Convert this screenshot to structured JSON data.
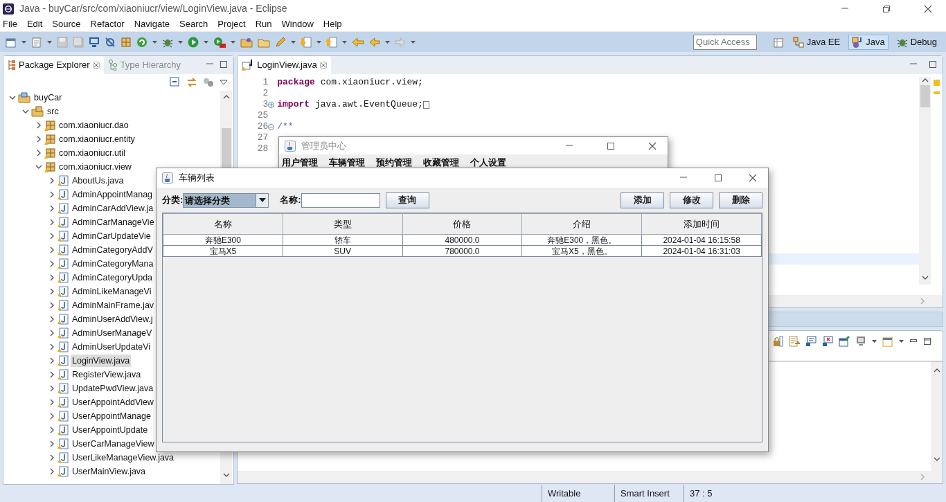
{
  "window": {
    "title": "Java - buyCar/src/com/xiaoniucr/view/LoginView.java - Eclipse"
  },
  "menu": [
    "File",
    "Edit",
    "Source",
    "Refactor",
    "Navigate",
    "Search",
    "Project",
    "Run",
    "Window",
    "Help"
  ],
  "quick_access": {
    "placeholder": "Quick Access"
  },
  "perspectives": [
    {
      "label": "Java EE",
      "selected": false
    },
    {
      "label": "Java",
      "selected": true
    },
    {
      "label": "Debug",
      "selected": false
    }
  ],
  "explorer": {
    "tabs": [
      {
        "label": "Package Explorer",
        "selected": true
      },
      {
        "label": "Type Hierarchy",
        "selected": false
      }
    ],
    "tree": [
      {
        "label": "buyCar",
        "kind": "project",
        "expanded": true,
        "selected": false,
        "children": [
          {
            "label": "src",
            "kind": "source",
            "expanded": true,
            "selected": false,
            "children": [
              {
                "label": "com.xiaoniucr.dao",
                "kind": "package",
                "expanded": false,
                "selected": false
              },
              {
                "label": "com.xiaoniucr.entity",
                "kind": "package",
                "expanded": false,
                "selected": false
              },
              {
                "label": "com.xiaoniucr.util",
                "kind": "package",
                "expanded": false,
                "selected": false
              },
              {
                "label": "com.xiaoniucr.view",
                "kind": "package",
                "expanded": true,
                "selected": false,
                "children": [
                  {
                    "label": "AboutUs.java",
                    "kind": "file",
                    "expanded": false,
                    "selected": false
                  },
                  {
                    "label": "AdminAppointManag",
                    "kind": "file",
                    "expanded": false,
                    "selected": false
                  },
                  {
                    "label": "AdminCarAddView.ja",
                    "kind": "file",
                    "expanded": false,
                    "selected": false
                  },
                  {
                    "label": "AdminCarManageVie",
                    "kind": "file",
                    "expanded": false,
                    "selected": false
                  },
                  {
                    "label": "AdminCarUpdateVie",
                    "kind": "file",
                    "expanded": false,
                    "selected": false
                  },
                  {
                    "label": "AdminCategoryAddV",
                    "kind": "file",
                    "expanded": false,
                    "selected": false
                  },
                  {
                    "label": "AdminCategoryMana",
                    "kind": "file",
                    "expanded": false,
                    "selected": false
                  },
                  {
                    "label": "AdminCategoryUpda",
                    "kind": "file",
                    "expanded": false,
                    "selected": false
                  },
                  {
                    "label": "AdminLikeManageVi",
                    "kind": "file",
                    "expanded": false,
                    "selected": false
                  },
                  {
                    "label": "AdminMainFrame.jav",
                    "kind": "file",
                    "expanded": false,
                    "selected": false
                  },
                  {
                    "label": "AdminUserAddView.j",
                    "kind": "file",
                    "expanded": false,
                    "selected": false
                  },
                  {
                    "label": "AdminUserManageV",
                    "kind": "file",
                    "expanded": false,
                    "selected": false
                  },
                  {
                    "label": "AdminUserUpdateVi",
                    "kind": "file",
                    "expanded": false,
                    "selected": false
                  },
                  {
                    "label": "LoginView.java",
                    "kind": "file",
                    "expanded": false,
                    "selected": true
                  },
                  {
                    "label": "RegisterView.java",
                    "kind": "file",
                    "expanded": false,
                    "selected": false
                  },
                  {
                    "label": "UpdatePwdView.java",
                    "kind": "file",
                    "expanded": false,
                    "selected": false
                  },
                  {
                    "label": "UserAppointAddView",
                    "kind": "file",
                    "expanded": false,
                    "selected": false
                  },
                  {
                    "label": "UserAppointManage",
                    "kind": "file",
                    "expanded": false,
                    "selected": false
                  },
                  {
                    "label": "UserAppointUpdate",
                    "kind": "file",
                    "expanded": false,
                    "selected": false
                  },
                  {
                    "label": "UserCarManageView",
                    "kind": "file",
                    "expanded": false,
                    "selected": false
                  },
                  {
                    "label": "UserLikeManageView.java",
                    "kind": "file",
                    "expanded": false,
                    "selected": false
                  },
                  {
                    "label": "UserMainView.java",
                    "kind": "file",
                    "expanded": false,
                    "selected": false
                  }
                ]
              }
            ]
          }
        ]
      }
    ]
  },
  "editor": {
    "tabs": [
      {
        "label": "LoginView.java",
        "selected": true
      }
    ],
    "lines": [
      {
        "number": "1",
        "kind": "code",
        "keyword": "package",
        "text": " com.xiaoniucr.view;"
      },
      {
        "number": "2",
        "kind": "blank"
      },
      {
        "number": "3",
        "kind": "code",
        "folded": true,
        "keyword": "import",
        "text": " java.awt.EventQueue;"
      },
      {
        "number": "25",
        "kind": "blank"
      },
      {
        "number": "26",
        "kind": "comment",
        "folded": false,
        "text": "/**"
      },
      {
        "number": "27",
        "kind": "blank"
      },
      {
        "number": "28",
        "kind": "blank"
      }
    ]
  },
  "admin_window": {
    "title": "管理员中心",
    "menu": [
      "用户管理",
      "车辆管理",
      "预约管理",
      "收藏管理",
      "个人设置"
    ]
  },
  "car_window": {
    "title": "车辆列表",
    "category_label": "分类:",
    "category_value": "请选择分类",
    "name_label": "名称:",
    "search_button": "查询",
    "actions": [
      "添加",
      "修改",
      "删除"
    ],
    "table": {
      "columns": [
        "名称",
        "类型",
        "价格",
        "介绍",
        "添加时间"
      ],
      "rows": [
        [
          "奔驰E300",
          "轿车",
          "480000.0",
          "奔驰E300，黑色。",
          "2024-01-04 16:15:58"
        ],
        [
          "宝马X5",
          "SUV",
          "780000.0",
          "宝马X5，黑色。",
          "2024-01-04 16:31:03"
        ]
      ]
    }
  },
  "status_bar": [
    "Writable",
    "Smart Insert",
    "37 : 5"
  ]
}
